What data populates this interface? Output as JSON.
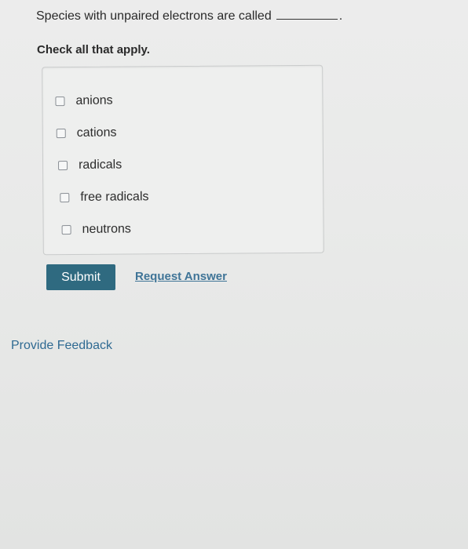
{
  "question": {
    "text": "Species with unpaired electrons are called",
    "end_punctuation": "."
  },
  "instruction": "Check all that apply.",
  "options": [
    {
      "label": "anions",
      "checked": false
    },
    {
      "label": "cations",
      "checked": false
    },
    {
      "label": "radicals",
      "checked": false
    },
    {
      "label": "free radicals",
      "checked": false
    },
    {
      "label": "neutrons",
      "checked": false
    }
  ],
  "actions": {
    "submit_label": "Submit",
    "request_answer_label": "Request Answer"
  },
  "footer": {
    "feedback_label": "Provide Feedback"
  },
  "colors": {
    "submit_bg": "#2f6a80",
    "link": "#3f7497"
  }
}
